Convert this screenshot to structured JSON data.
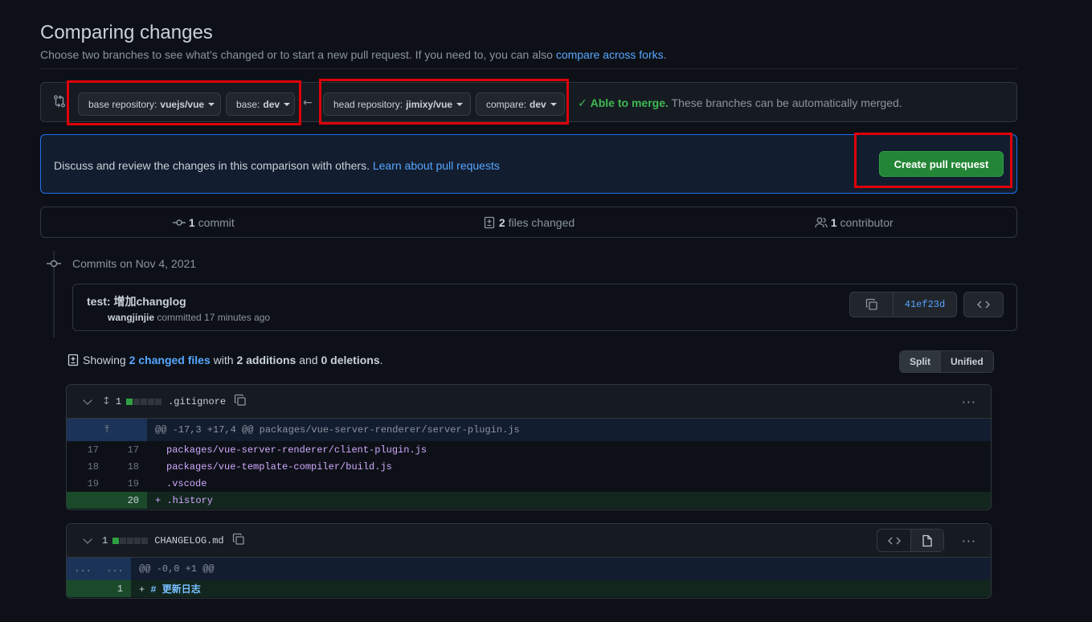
{
  "header": {
    "title": "Comparing changes",
    "subtitle_prefix": "Choose two branches to see what’s changed or to start a new pull request. If you need to, you can also ",
    "subtitle_link": "compare across forks",
    "subtitle_suffix": "."
  },
  "range": {
    "base_repo_label": "base repository:",
    "base_repo_value": "vuejs/vue",
    "base_label": "base:",
    "base_value": "dev",
    "head_repo_label": "head repository:",
    "head_repo_value": "jimixy/vue",
    "compare_label": "compare:",
    "compare_value": "dev",
    "merge_status": "Able to merge.",
    "merge_note": " These branches can be automatically merged."
  },
  "discuss": {
    "text": "Discuss and review the changes in this comparison with others. ",
    "link": "Learn about pull requests",
    "create_button": "Create pull request"
  },
  "summary": {
    "commits_count": "1",
    "commits_label": "commit",
    "files_count": "2",
    "files_label": "files changed",
    "contributors_count": "1",
    "contributors_label": "contributor"
  },
  "commits": {
    "date_label": "Commits on Nov 4, 2021",
    "title": "test: 增加changlog",
    "author": "wangjinjie",
    "meta": " committed 17 minutes ago",
    "sha": "41ef23d"
  },
  "showing": {
    "prefix": "Showing ",
    "files_link": "2 changed files",
    "middle": " with ",
    "additions": "2 additions",
    "and": " and ",
    "deletions": "0 deletions",
    "end": ".",
    "split": "Split",
    "unified": "Unified"
  },
  "files": [
    {
      "count": "1",
      "name": ".gitignore",
      "hunk": "@@ -17,3 +17,4 @@ packages/vue-server-renderer/server-plugin.js",
      "lines": [
        {
          "old": "17",
          "new": "17",
          "code": "packages/vue-server-renderer/client-plugin.js"
        },
        {
          "old": "18",
          "new": "18",
          "code": "packages/vue-template-compiler/build.js"
        },
        {
          "old": "19",
          "new": "19",
          "code": ".vscode"
        },
        {
          "old": "",
          "new": "20",
          "code": "+ .history"
        }
      ]
    },
    {
      "count": "1",
      "name": "CHANGELOG.md",
      "hunk_old": "...",
      "hunk_new": "...",
      "hunk": "@@ -0,0 +1 @@",
      "lines": [
        {
          "old": "",
          "new": "1",
          "prefix": "+ ",
          "code": "# 更新日志"
        }
      ]
    }
  ]
}
